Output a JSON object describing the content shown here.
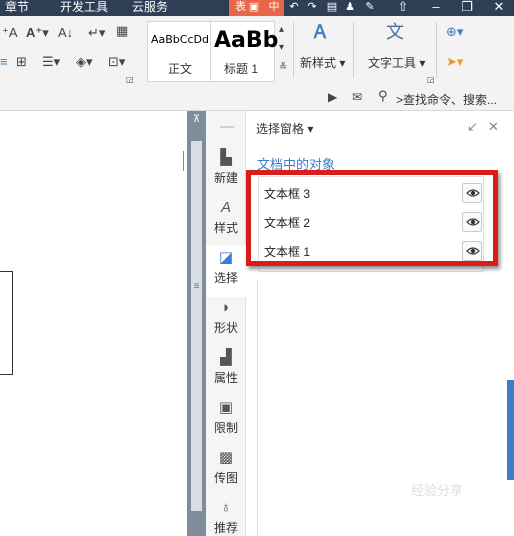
{
  "tabs": [
    "章节",
    "开发工具",
    "云服务"
  ],
  "highlight_tab_partial": "表",
  "ribbon": {
    "style_normal_sample": "AaBbCcDd",
    "style_normal_name": "正文",
    "style_h1_sample": "AaBb",
    "style_h1_name": "标题 1",
    "new_style_label": "新样式",
    "text_tools_label": "文字工具",
    "search_placeholder": ">查找命令、搜索..."
  },
  "sidebar": {
    "items": [
      {
        "label": "新建",
        "icon": "new-doc-icon"
      },
      {
        "label": "样式",
        "icon": "style-icon"
      },
      {
        "label": "选择",
        "icon": "select-icon"
      },
      {
        "label": "形状",
        "icon": "shape-icon"
      },
      {
        "label": "属性",
        "icon": "property-icon"
      },
      {
        "label": "限制",
        "icon": "restrict-icon"
      },
      {
        "label": "传图",
        "icon": "upload-image-icon"
      },
      {
        "label": "推荐",
        "icon": "recommend-icon"
      }
    ]
  },
  "panel": {
    "title": "选择窗格",
    "subtitle": "文档中的对象",
    "objects": [
      "文本框 3",
      "文本框 2",
      "文本框 1"
    ]
  },
  "watermark": "经验分享",
  "colors": {
    "accent": "#3a7ec9",
    "highlight_frame": "#d91c1c",
    "tabbar": "#2e3f55"
  }
}
